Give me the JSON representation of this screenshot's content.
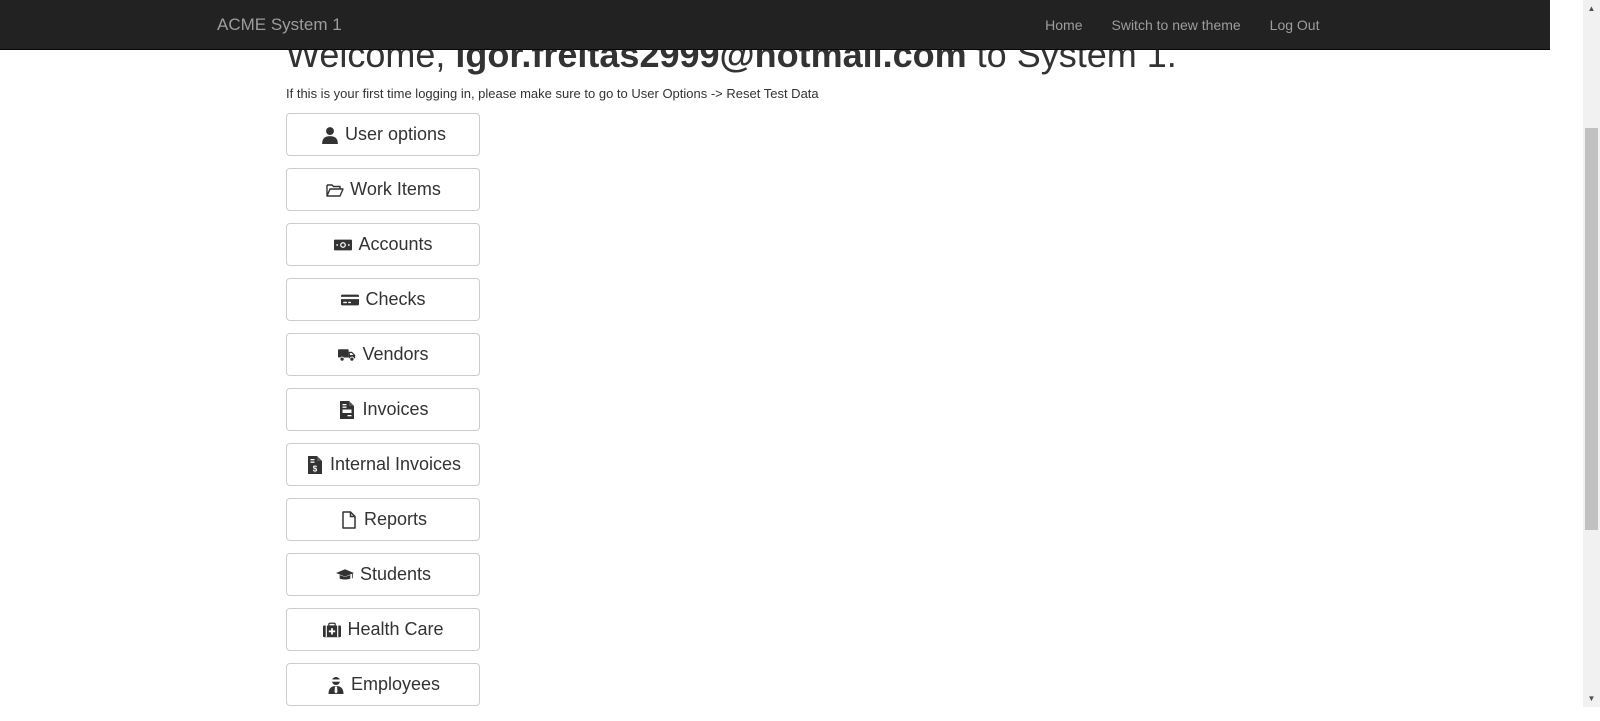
{
  "navbar": {
    "brand": "ACME System 1",
    "links": [
      {
        "label": "Home"
      },
      {
        "label": "Switch to new theme"
      },
      {
        "label": "Log Out"
      }
    ]
  },
  "main": {
    "welcome_prefix": "Welcome, ",
    "welcome_user": "igor.freitas2999@hotmail.com",
    "welcome_suffix": " to System 1.",
    "notice": "If this is your first time logging in, please make sure to go to User Options -> Reset Test Data",
    "menu": [
      {
        "label": "User options",
        "icon": "user-icon"
      },
      {
        "label": "Work Items",
        "icon": "folder-open-icon"
      },
      {
        "label": "Accounts",
        "icon": "money-bill-icon"
      },
      {
        "label": "Checks",
        "icon": "credit-card-icon"
      },
      {
        "label": "Vendors",
        "icon": "truck-icon"
      },
      {
        "label": "Invoices",
        "icon": "file-invoice-icon"
      },
      {
        "label": "Internal Invoices",
        "icon": "file-invoice-dollar-icon"
      },
      {
        "label": "Reports",
        "icon": "file-icon"
      },
      {
        "label": "Students",
        "icon": "graduation-cap-icon"
      },
      {
        "label": "Health Care",
        "icon": "medkit-icon"
      },
      {
        "label": "Employees",
        "icon": "user-tie-icon"
      }
    ]
  }
}
